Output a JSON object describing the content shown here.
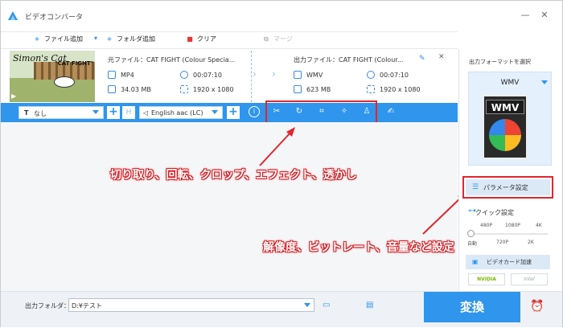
{
  "app": {
    "title": "ビデオコンバータ"
  },
  "window": {
    "minimize": "—",
    "close": "✕"
  },
  "toolbar": {
    "add_file": "ファイル追加",
    "add_folder": "フォルダ追加",
    "clear": "クリア",
    "merge": "マージ"
  },
  "file": {
    "source_label": "元ファイル：CAT FIGHT (Colour Specia...",
    "source_format": "MP4",
    "source_duration": "00:07:10",
    "source_size": "34.03 MB",
    "source_resolution": "1920 x 1080",
    "output_label": "出力ファイル：CAT FIGHT (Colour...",
    "output_format": "WMV",
    "output_duration": "00:07:10",
    "output_size": "623 MB",
    "output_resolution": "1920 x 1080",
    "thumb_title": "Simon's Cat",
    "thumb_caption": "\"CAT FIGHT\""
  },
  "editbar": {
    "subtitle": "なし",
    "audio": "English aac (LC)",
    "subtitle_h": "H"
  },
  "callouts": {
    "tools": "切り取り、回転、クロップ、エフェクト、透かし",
    "params": "解像度、ビットレート、音量など設定"
  },
  "sidebar": {
    "title": "出力フォーマットを選択",
    "format": "WMV",
    "format_icon_label": "WMV",
    "param_button": "パラメータ設定",
    "quick_setting": "クイック設定",
    "ticks_top": [
      "480P",
      "1080P",
      "4K"
    ],
    "ticks_bottom": [
      "自動",
      "720P",
      "2K"
    ],
    "gpu_button": "ビデオカード加速",
    "nvidia": "NVIDIA",
    "intel": "Intel"
  },
  "bottom": {
    "output_folder_label": "出力フォルダ：",
    "output_folder_value": "D:¥テスト",
    "convert_button": "変換"
  },
  "colors": {
    "accent": "#2f95ed",
    "callout": "#e1262c"
  }
}
